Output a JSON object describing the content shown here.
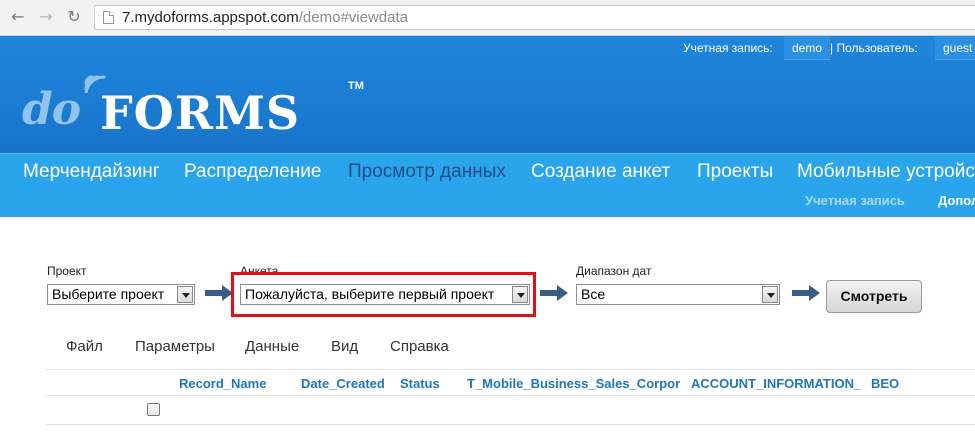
{
  "browser": {
    "url_host": "7.mydoforms.appspot.com",
    "url_path": "/demo#viewdata"
  },
  "account": {
    "account_label": "Учетная запись:",
    "account_value": "demo",
    "user_label": "| Пользователь:",
    "user_value": "guest"
  },
  "logo": {
    "do": "do",
    "forms": "FORMS",
    "tm": "TM"
  },
  "nav": {
    "items": [
      {
        "label": "Мерчендайзинг"
      },
      {
        "label": "Распределение"
      },
      {
        "label": "Просмотр данных"
      },
      {
        "label": "Создание анкет"
      },
      {
        "label": "Проекты"
      },
      {
        "label": "Мобильные устройс"
      }
    ],
    "active_index": 2,
    "sub_items": [
      {
        "label": "Учетная запись"
      },
      {
        "label": "Допол"
      }
    ]
  },
  "filters": {
    "project_label": "Проект",
    "project_value": "Выберите проект",
    "form_label": "Анкета",
    "form_value": "Пожалуйста, выберите первый проект",
    "date_label": "Диапазон дат",
    "date_value": "Все",
    "view_button": "Смотреть"
  },
  "menu": {
    "items": [
      {
        "label": "Файл"
      },
      {
        "label": "Параметры"
      },
      {
        "label": "Данные"
      },
      {
        "label": "Вид"
      },
      {
        "label": "Справка"
      }
    ]
  },
  "grid": {
    "columns": [
      {
        "label": "Record_Name"
      },
      {
        "label": "Date_Created"
      },
      {
        "label": "Status"
      },
      {
        "label": "T_Mobile_Business_Sales_Corpor"
      },
      {
        "label": "ACCOUNT_INFORMATION_"
      },
      {
        "label": "BEO"
      }
    ]
  },
  "colors": {
    "header_blue": "#1f86dd",
    "nav_blue": "#2aa5ec",
    "active_nav": "#1f4f86",
    "arrow": "#3a5d85",
    "highlight": "#e0101a",
    "column_header": "#2277bb"
  }
}
